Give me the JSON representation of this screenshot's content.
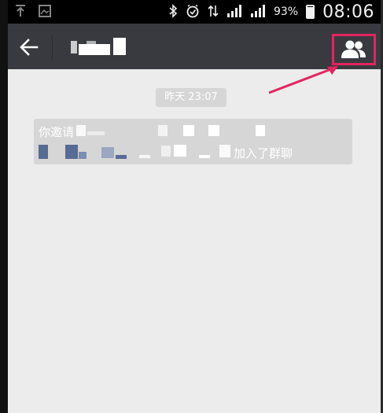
{
  "status_bar": {
    "battery_percent": "93%",
    "battery_level": 0.93,
    "time": "08:06",
    "icons": [
      "upload-icon",
      "image-icon",
      "bluetooth-icon",
      "alarm-icon",
      "data-arrows-icon",
      "signal-icon",
      "signal-icon"
    ]
  },
  "header": {
    "back_icon": "arrow-left-icon",
    "members_icon": "group-members-icon"
  },
  "chat": {
    "timestamp": "昨天 23:07",
    "system_message": {
      "prefix": "你邀请",
      "suffix": "加入了群聊"
    }
  },
  "colors": {
    "status_bar_bg": "#000000",
    "header_bg": "#393a3f",
    "chat_bg": "#ececec",
    "pill_bg": "#d6d6d6",
    "highlight": "#e3245f",
    "name_link": "#576b95"
  }
}
